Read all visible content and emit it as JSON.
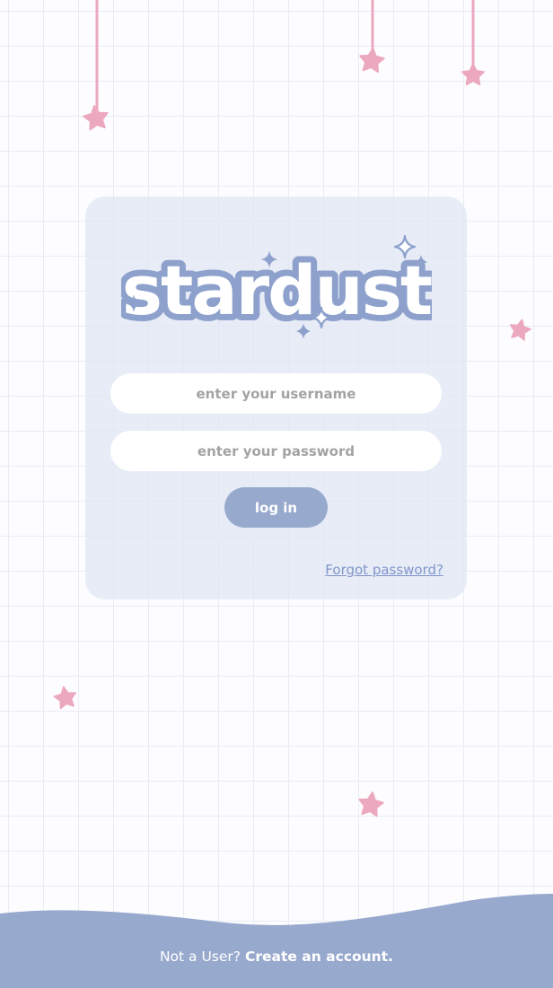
{
  "app": {
    "logo_text": "stardust"
  },
  "login_form": {
    "username_placeholder": "enter your username",
    "password_placeholder": "enter your password",
    "login_button": "log in",
    "forgot_link": "Forgot password?"
  },
  "footer": {
    "prompt": "Not a User?",
    "create_link": "Create an account."
  },
  "colors": {
    "star_pink": "#eca8be",
    "periwinkle": "#98a9ce",
    "link_blue": "#8296cc",
    "card_bg": "#e0e7f3"
  },
  "icons": [
    "star-icon",
    "sparkle-icon"
  ]
}
